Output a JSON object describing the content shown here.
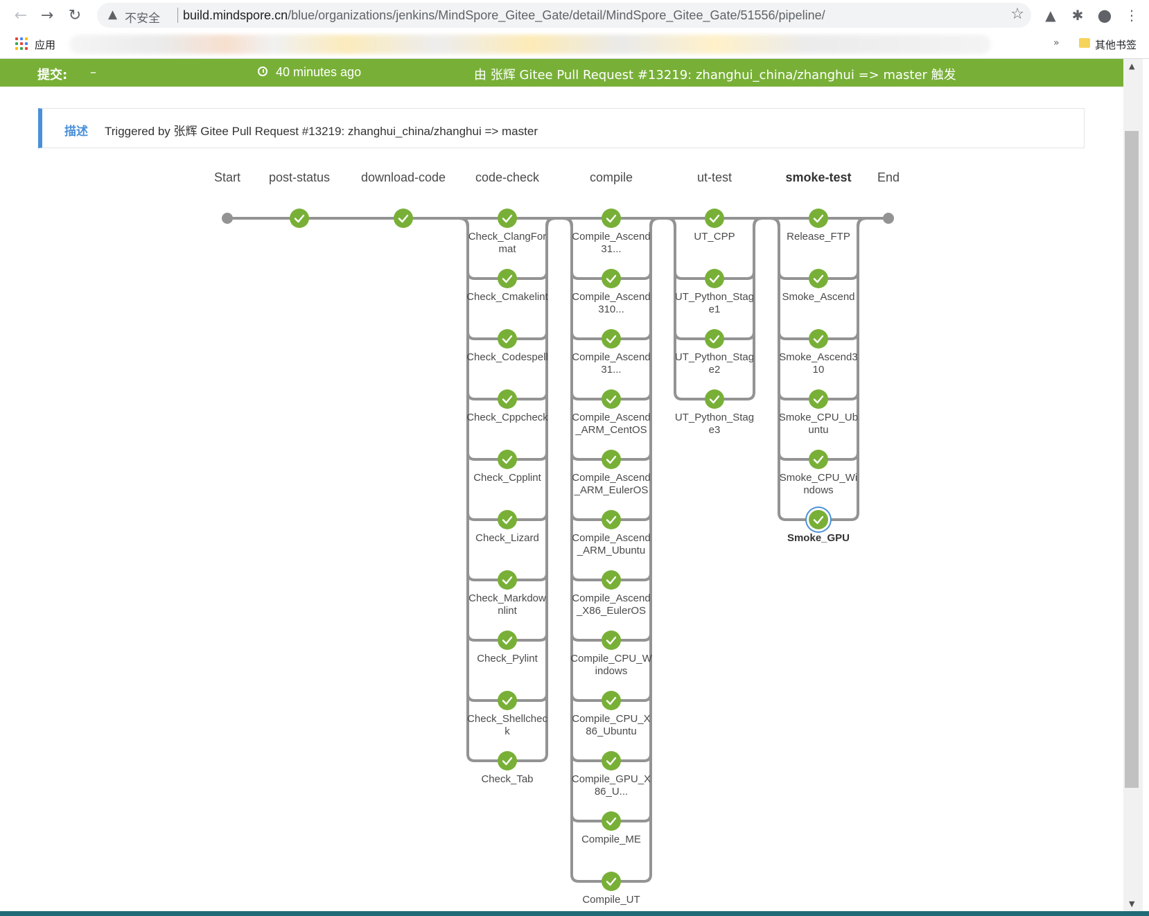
{
  "browser": {
    "insecure_label": "不安全",
    "url_host": "build.mindspore.cn",
    "url_path": "/blue/organizations/jenkins/MindSpore_Gitee_Gate/detail/MindSpore_Gitee_Gate/51556/pipeline/",
    "apps_label": "应用",
    "other_bookmarks": "其他书签"
  },
  "run": {
    "commit_label": "提交:",
    "commit_value": "–",
    "time_ago": "40 minutes ago",
    "cause": "由 张辉 Gitee Pull Request #13219: zhanghui_china/zhanghui => master 触发"
  },
  "description": {
    "label": "描述",
    "text": "Triggered by 张辉 Gitee Pull Request #13219: zhanghui_china/zhanghui => master"
  },
  "pipeline": {
    "start_label": "Start",
    "end_label": "End",
    "stages": [
      {
        "name": "post-status",
        "status": "success",
        "branches": []
      },
      {
        "name": "download-code",
        "status": "success",
        "branches": []
      },
      {
        "name": "code-check",
        "status": "success",
        "branches": [
          "Check_ClangFormat",
          "Check_Cmakelint",
          "Check_Codespell",
          "Check_Cppcheck",
          "Check_Cpplint",
          "Check_Lizard",
          "Check_Markdownlint",
          "Check_Pylint",
          "Check_Shellcheck",
          "Check_Tab"
        ]
      },
      {
        "name": "compile",
        "status": "success",
        "branches": [
          "Compile_Ascend31...",
          "Compile_Ascend310...",
          "Compile_Ascend31...",
          "Compile_Ascend_ARM_CentOS",
          "Compile_Ascend_ARM_EulerOS",
          "Compile_Ascend_ARM_Ubuntu",
          "Compile_Ascend_X86_EulerOS",
          "Compile_CPU_Windows",
          "Compile_CPU_X86_Ubuntu",
          "Compile_GPU_X86_U...",
          "Compile_ME",
          "Compile_UT"
        ]
      },
      {
        "name": "ut-test",
        "status": "success",
        "branches": [
          "UT_CPP",
          "UT_Python_Stage1",
          "UT_Python_Stage2",
          "UT_Python_Stage3"
        ]
      },
      {
        "name": "smoke-test",
        "status": "success",
        "selected": true,
        "branches": [
          "Release_FTP",
          "Smoke_Ascend",
          "Smoke_Ascend310",
          "Smoke_CPU_Ubuntu",
          "Smoke_CPU_Windows",
          "Smoke_GPU"
        ]
      }
    ],
    "selected_branch": "Smoke_GPU"
  },
  "colors": {
    "success": "#78b037",
    "selected_ring": "#4a90d9",
    "connector": "#949393"
  }
}
